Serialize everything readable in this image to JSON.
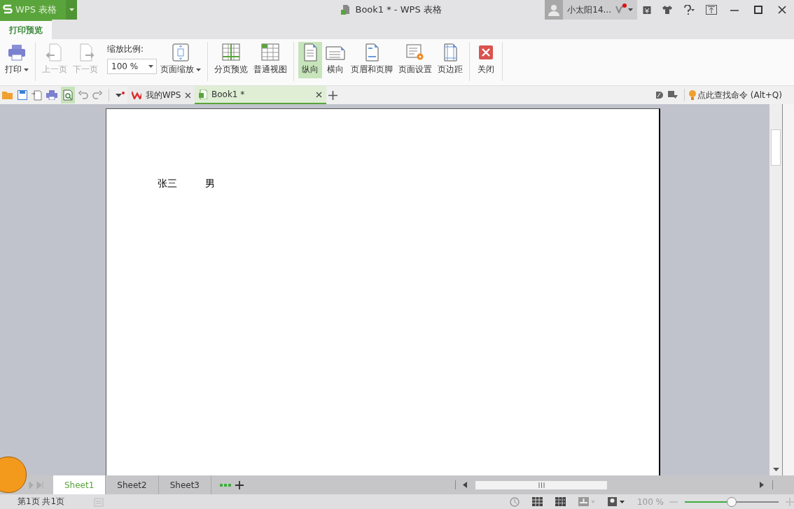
{
  "app_menu": {
    "label": "WPS 表格"
  },
  "window": {
    "title": "Book1 * - WPS 表格"
  },
  "user": {
    "name": "小太阳14...",
    "notification": true
  },
  "ribbon_tabs": [
    {
      "label": "打印预览",
      "selected": true
    }
  ],
  "ribbon": {
    "groups": [
      [
        {
          "kind": "button",
          "label": "打印",
          "dropdown": true,
          "disabled": false
        }
      ],
      [
        {
          "kind": "button",
          "label": "上一页",
          "dropdown": false,
          "disabled": true
        },
        {
          "kind": "button",
          "label": "下一页",
          "dropdown": false,
          "disabled": true
        },
        {
          "kind": "zoom",
          "label": "缩放比例:",
          "value": "100 %"
        },
        {
          "kind": "button",
          "label": "页面缩放",
          "dropdown": true,
          "disabled": false
        }
      ],
      [
        {
          "kind": "button",
          "label": "分页预览",
          "dropdown": false,
          "disabled": false
        },
        {
          "kind": "button",
          "label": "普通视图",
          "dropdown": false,
          "disabled": false
        }
      ],
      [
        {
          "kind": "toggle",
          "label": "纵向",
          "selected": true
        },
        {
          "kind": "toggle",
          "label": "横向",
          "selected": false
        },
        {
          "kind": "button",
          "label": "页眉和页脚",
          "dropdown": false,
          "disabled": false
        },
        {
          "kind": "button",
          "label": "页面设置",
          "dropdown": false,
          "disabled": false
        },
        {
          "kind": "button",
          "label": "页边距",
          "dropdown": false,
          "disabled": false
        }
      ],
      [
        {
          "kind": "button",
          "label": "关闭",
          "dropdown": false,
          "disabled": false
        }
      ]
    ]
  },
  "doc_tabs": [
    {
      "label": "我的WPS",
      "selected": false
    },
    {
      "label": "Book1 *",
      "selected": true
    }
  ],
  "command_search": {
    "placeholder": "点此查找命令 (Alt+Q)"
  },
  "page": {
    "rows": [
      [
        "张三",
        "男"
      ]
    ]
  },
  "sheet_tabs": [
    {
      "label": "Sheet1",
      "selected": true
    },
    {
      "label": "Sheet2",
      "selected": false
    },
    {
      "label": "Sheet3",
      "selected": false
    }
  ],
  "status_bar": {
    "page_info": "第1页 共1页",
    "zoom": "100 %",
    "level": 0.5
  }
}
